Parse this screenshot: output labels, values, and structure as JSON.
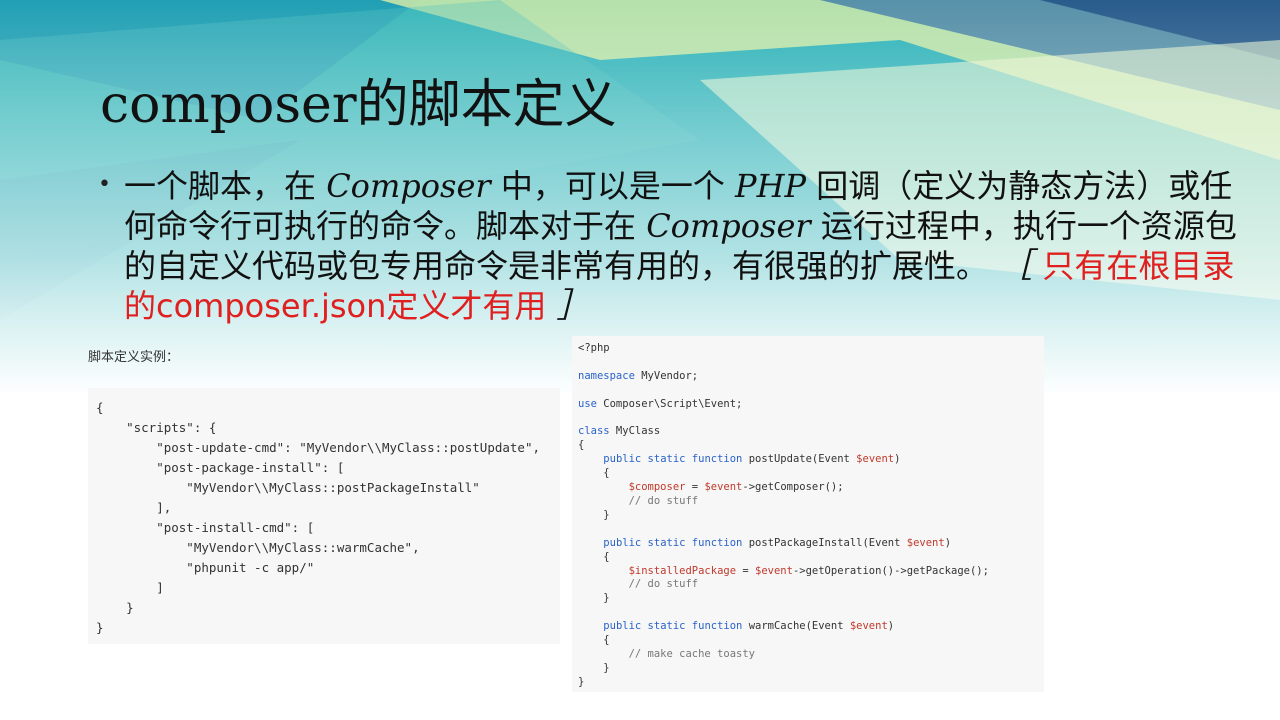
{
  "title": "composer的脚本定义",
  "bullet": {
    "p1": "一个脚本，在 ",
    "composer1": "Composer",
    "p2": " 中，可以是一个 ",
    "php": "PHP",
    "p3": " 回调（定义为静态方法）或任何命令行可执行的命令。脚本对于在 ",
    "composer2": "Composer",
    "p4": " 运行过程中，执行一个资源包的自定义代码或包专用命令是非常有用的，有很强的扩展性。",
    "bracket_open": "［",
    "note": "只有在根目录的composer.json定义才有用",
    "bracket_close": "］"
  },
  "example_label": "脚本定义实例：",
  "json_code": {
    "lines": [
      "{",
      "    \"scripts\": {",
      "        \"post-update-cmd\": \"MyVendor\\\\MyClass::postUpdate\",",
      "        \"post-package-install\": [",
      "            \"MyVendor\\\\MyClass::postPackageInstall\"",
      "        ],",
      "        \"post-install-cmd\": [",
      "            \"MyVendor\\\\MyClass::warmCache\",",
      "            \"phpunit -c app/\"",
      "        ]",
      "    }",
      "}"
    ]
  },
  "php_code": {
    "open_tag": "<?php",
    "namespace_kw": "namespace",
    "namespace_name": " MyVendor;",
    "use_kw": "use",
    "use_path": " Composer\\Script\\Event;",
    "class_kw": "class",
    "class_name": " MyClass",
    "brace_open": "{",
    "brace_close": "}",
    "method_mods": "public static function",
    "m1_name": " postUpdate(Event ",
    "m1_var": "$event",
    "m1_body_var": "$composer",
    "m1_body_eq": " = ",
    "m1_body_call_var": "$event",
    "m1_body_call": "->getComposer();",
    "m1_comment": "// do stuff",
    "m2_name": " postPackageInstall(Event ",
    "m2_var": "$event",
    "m2_body_var": "$installedPackage",
    "m2_body_eq": " = ",
    "m2_body_call_var": "$event",
    "m2_body_call": "->getOperation()->getPackage();",
    "m2_comment": "// do stuff",
    "m3_name": " warmCache(Event ",
    "m3_var": "$event",
    "m3_comment": "// make cache toasty",
    "paren_close": ")"
  },
  "colors": {
    "keyword": "#2a62c9",
    "variable": "#c0392b",
    "note": "#e02020"
  }
}
